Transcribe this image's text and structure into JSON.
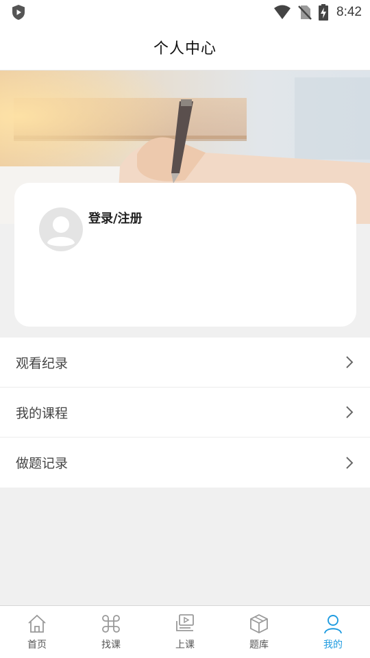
{
  "status_bar": {
    "time": "8:42"
  },
  "header": {
    "title": "个人中心"
  },
  "profile": {
    "login_label": "登录/注册"
  },
  "menu": {
    "items": [
      {
        "label": "观看纪录",
        "icon": "chevron-right-icon"
      },
      {
        "label": "我的课程",
        "icon": "chevron-right-icon"
      },
      {
        "label": "做题记录",
        "icon": "chevron-right-icon"
      }
    ]
  },
  "tabbar": {
    "items": [
      {
        "label": "首页",
        "icon": "home-icon"
      },
      {
        "label": "找课",
        "icon": "command-icon"
      },
      {
        "label": "上课",
        "icon": "video-lesson-icon"
      },
      {
        "label": "题库",
        "icon": "cube-icon"
      },
      {
        "label": "我的",
        "icon": "user-icon",
        "active": true
      }
    ]
  },
  "colors": {
    "accent": "#1e9be0",
    "page_bg": "#f0f0f0",
    "card_bg": "#ffffff",
    "text_dark": "#222222",
    "icon_gray": "#aaaaaa"
  }
}
